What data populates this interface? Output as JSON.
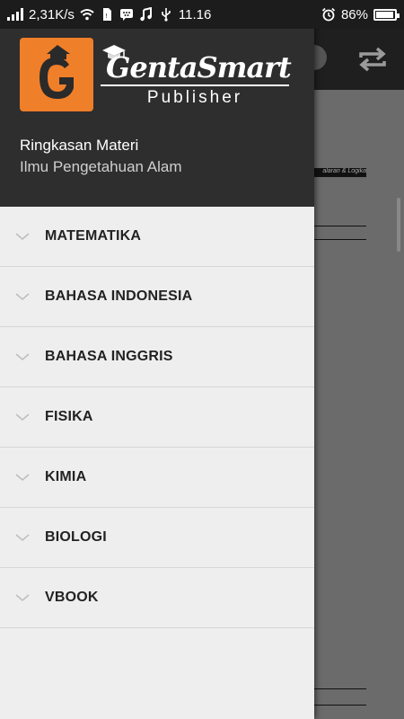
{
  "status_bar": {
    "net_speed": "2,31K/s",
    "time": "11.16",
    "battery": "86%",
    "battery_level": 0.86
  },
  "header": {
    "brand_name": "GentaSmart",
    "brand_sub": "Publisher",
    "logo_letter": "G",
    "title": "Ringkasan Materi",
    "subtitle": "Ilmu Pengetahuan Alam"
  },
  "menu": {
    "items": [
      {
        "label": "MATEMATIKA"
      },
      {
        "label": "BAHASA INDONESIA"
      },
      {
        "label": "BAHASA INGGRIS"
      },
      {
        "label": "FISIKA"
      },
      {
        "label": "KIMIA"
      },
      {
        "label": "BIOLOGI"
      },
      {
        "label": "VBOOK"
      }
    ]
  },
  "background": {
    "page_strip_text": "alaran & Logika"
  },
  "colors": {
    "accent": "#f07f2a",
    "header_bg": "#2e2e2e",
    "drawer_bg": "#eeeeee"
  }
}
